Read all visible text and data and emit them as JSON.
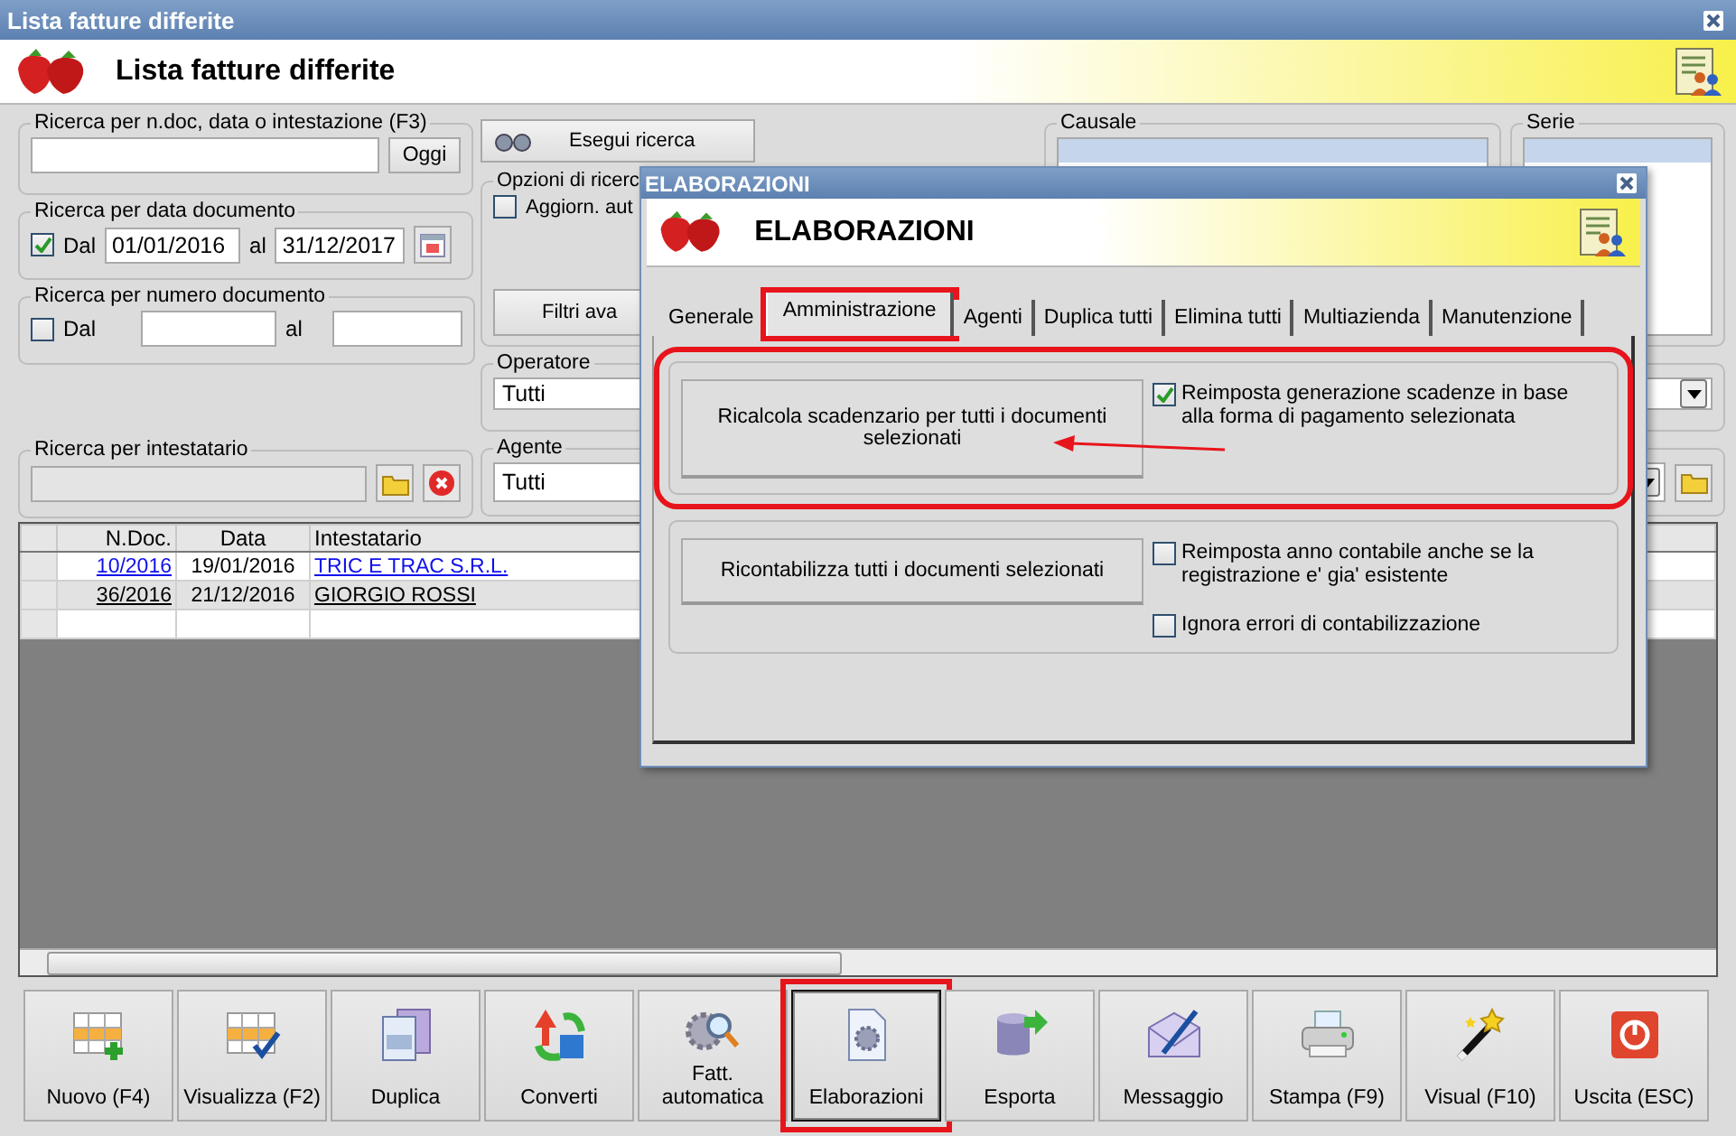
{
  "window": {
    "title": "Lista fatture differite",
    "header": "Lista fatture differite"
  },
  "search": {
    "legend": "Ricerca per n.doc, data o intestazione (F3)",
    "today_button": "Oggi"
  },
  "date_search": {
    "legend": "Ricerca per data documento",
    "from_label": "Dal",
    "checked": true,
    "from": "01/01/2016",
    "to_label": "al",
    "to": "31/12/2017"
  },
  "number_search": {
    "legend": "Ricerca per numero documento",
    "from_label": "Dal",
    "checked": false,
    "to_label": "al"
  },
  "holder_search": {
    "legend": "Ricerca per intestatario"
  },
  "search_button": "Esegui ricerca",
  "options": {
    "legend": "Opzioni di ricerc",
    "auto_update": {
      "label": "Aggiorn. aut",
      "checked": false
    },
    "filters_button": "Filtri ava"
  },
  "causale": {
    "legend": "Causale"
  },
  "serie": {
    "legend": "Serie"
  },
  "operatore": {
    "legend": "Operatore",
    "value": "Tutti"
  },
  "agente": {
    "legend": "Agente",
    "value": "Tutti"
  },
  "table": {
    "columns": [
      "N.Doc.",
      "Data",
      "Intestatario"
    ],
    "rows": [
      {
        "selected": false,
        "cells": [
          "10/2016",
          "19/01/2016",
          "TRIC E TRAC S.R.L."
        ]
      },
      {
        "selected": true,
        "cells": [
          "36/2016",
          "21/12/2016",
          "GIORGIO ROSSI"
        ]
      }
    ]
  },
  "toolbar": [
    {
      "label": "Nuovo (F4)",
      "selected": false,
      "highlighted": false
    },
    {
      "label": "Visualizza (F2)",
      "selected": false,
      "highlighted": false
    },
    {
      "label": "Duplica",
      "selected": false,
      "highlighted": false
    },
    {
      "label": "Converti",
      "selected": false,
      "highlighted": false
    },
    {
      "label": "Fatt.\nautomatica",
      "selected": false,
      "highlighted": false
    },
    {
      "label": "Elaborazioni",
      "selected": true,
      "highlighted": true
    },
    {
      "label": "Esporta",
      "selected": false,
      "highlighted": false
    },
    {
      "label": "Messaggio",
      "selected": false,
      "highlighted": false
    },
    {
      "label": "Stampa (F9)",
      "selected": false,
      "highlighted": false
    },
    {
      "label": "Visual (F10)",
      "selected": false,
      "highlighted": false
    },
    {
      "label": "Uscita (ESC)",
      "selected": false,
      "highlighted": false
    }
  ],
  "dialog": {
    "title": "ELABORAZIONI",
    "header": "ELABORAZIONI",
    "tabs": [
      {
        "label": "Generale",
        "selected": false,
        "highlighted": false
      },
      {
        "label": "Amministrazione",
        "selected": true,
        "highlighted": true
      },
      {
        "label": "Agenti",
        "selected": false,
        "highlighted": false
      },
      {
        "label": "Duplica tutti",
        "selected": false,
        "highlighted": false
      },
      {
        "label": "Elimina tutti",
        "selected": false,
        "highlighted": false
      },
      {
        "label": "Multiazienda",
        "selected": false,
        "highlighted": false
      },
      {
        "label": "Manutenzione",
        "selected": false,
        "highlighted": false
      }
    ],
    "sections": [
      {
        "highlighted": true,
        "button": "Ricalcola scadenzario per tutti i documenti selezionati",
        "options": [
          {
            "label": "Reimposta generazione scadenze in base alla forma di pagamento selezionata",
            "checked": true
          }
        ]
      },
      {
        "highlighted": false,
        "button": "Ricontabilizza tutti i documenti selezionati",
        "options": [
          {
            "label": "Reimposta anno contabile anche se la registrazione e' gia' esistente",
            "checked": false
          },
          {
            "label": "Ignora errori di contabilizzazione",
            "checked": false
          }
        ]
      }
    ]
  }
}
